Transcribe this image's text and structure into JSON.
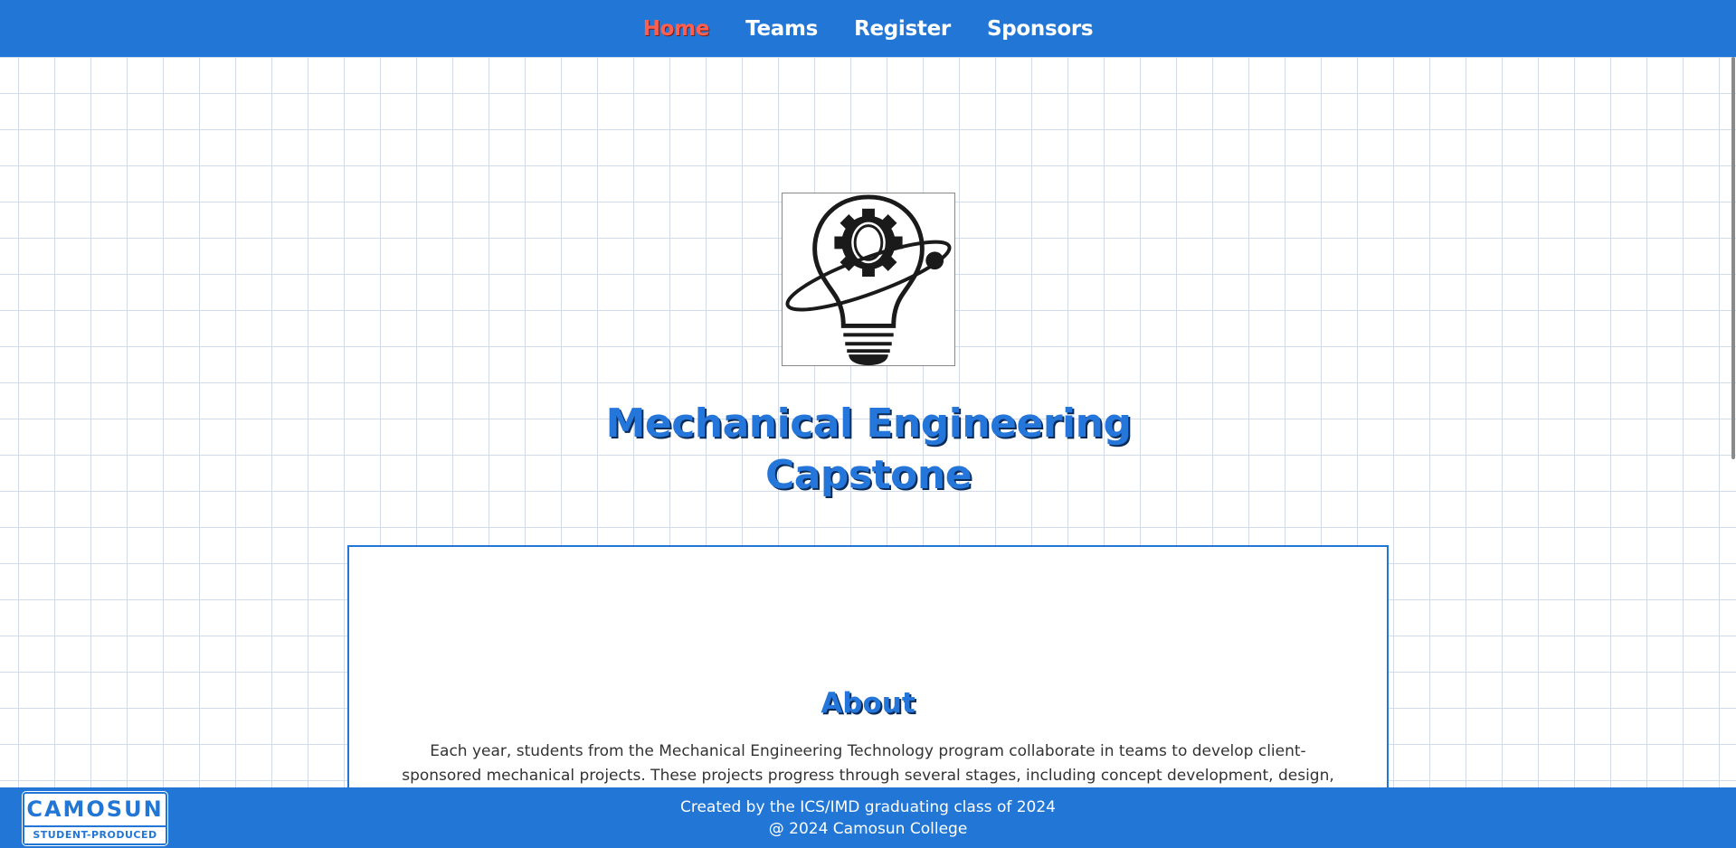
{
  "nav": {
    "items": [
      {
        "label": "Home",
        "active": true
      },
      {
        "label": "Teams",
        "active": false
      },
      {
        "label": "Register",
        "active": false
      },
      {
        "label": "Sponsors",
        "active": false
      }
    ]
  },
  "hero": {
    "logo_icon": "lightbulb-gear-orbit-icon",
    "title_line1": "Mechanical Engineering",
    "title_line2": "Capstone"
  },
  "about": {
    "heading": "About",
    "text": "Each year, students from the Mechanical Engineering Technology program collaborate in teams to develop client-sponsored mechanical projects. These projects progress through several stages, including concept development, design, prototyping,"
  },
  "footer": {
    "line1": "Created by the ICS/IMD graduating class of 2024",
    "line2": "@ 2024 Camosun College",
    "badge_top": "CAMOSUN",
    "badge_bottom": "STUDENT-PRODUCED"
  },
  "colors": {
    "brand_blue": "#2176d6",
    "active_nav": "#ff5f4f",
    "heading_blue": "#2576da"
  }
}
